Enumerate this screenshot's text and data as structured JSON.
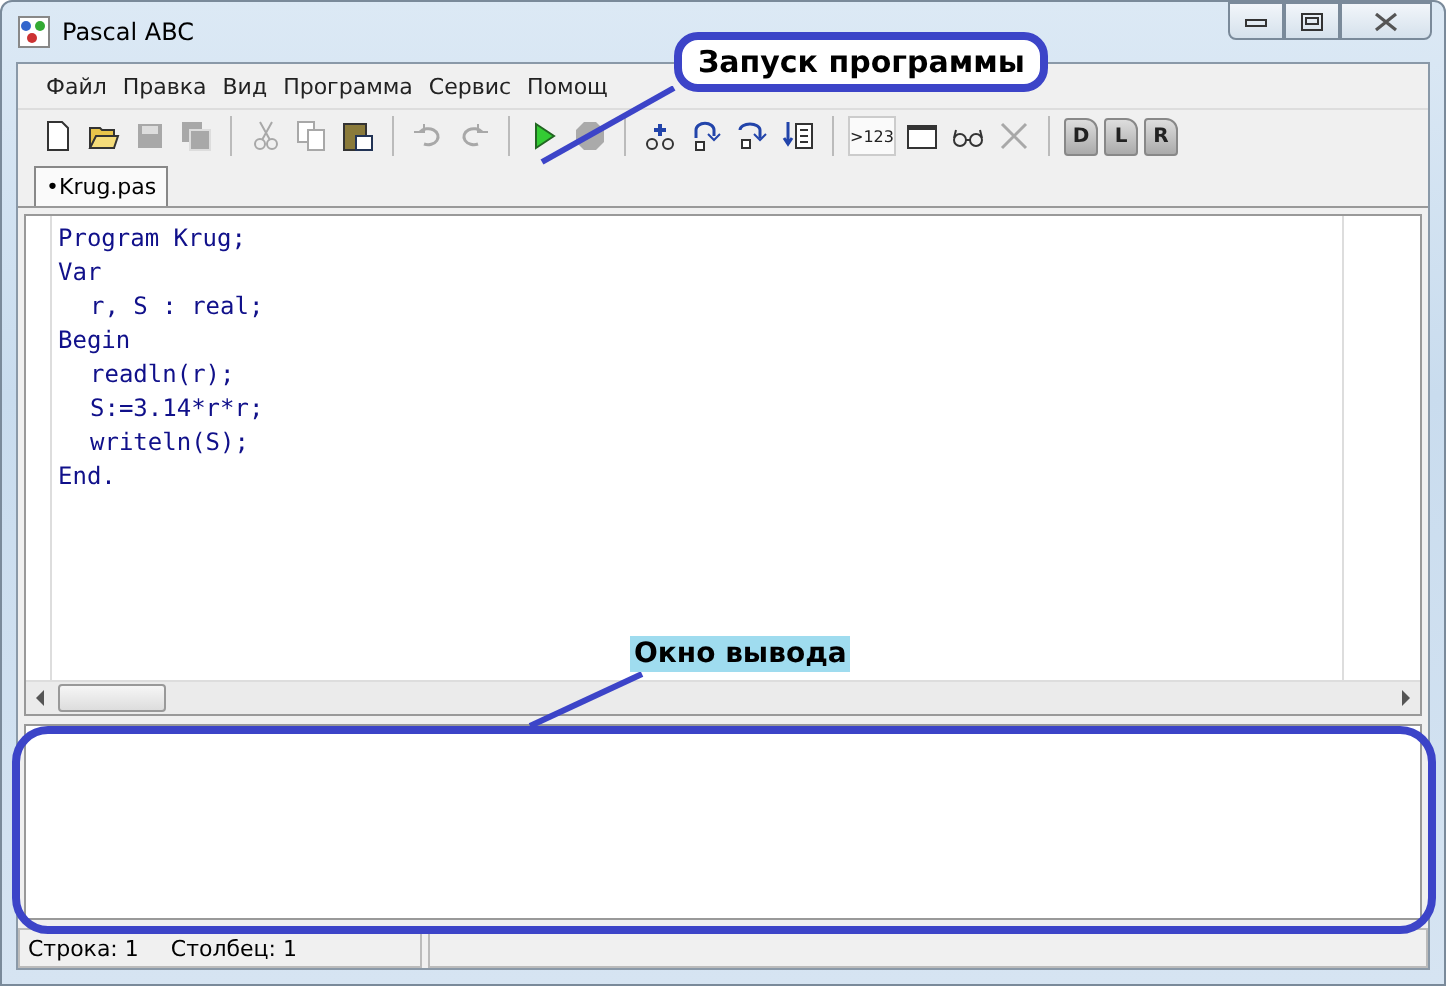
{
  "window": {
    "title": "Pascal ABC"
  },
  "menu": [
    {
      "label": "Файл"
    },
    {
      "label": "Правка"
    },
    {
      "label": "Вид"
    },
    {
      "label": "Программа"
    },
    {
      "label": "Сервис"
    },
    {
      "label": "Помощ"
    }
  ],
  "toolbar": [
    {
      "kind": "new",
      "disabled": false
    },
    {
      "kind": "open",
      "disabled": false
    },
    {
      "kind": "save",
      "disabled": true
    },
    {
      "kind": "saveall",
      "disabled": true
    },
    {
      "kind": "sep"
    },
    {
      "kind": "cut",
      "disabled": true
    },
    {
      "kind": "copy",
      "disabled": true
    },
    {
      "kind": "paste",
      "disabled": false
    },
    {
      "kind": "sep"
    },
    {
      "kind": "undo",
      "disabled": true
    },
    {
      "kind": "redo",
      "disabled": true
    },
    {
      "kind": "sep"
    },
    {
      "kind": "run",
      "disabled": false
    },
    {
      "kind": "stop",
      "disabled": true
    },
    {
      "kind": "sep"
    },
    {
      "kind": "watch",
      "disabled": false
    },
    {
      "kind": "stepover",
      "disabled": false
    },
    {
      "kind": "stepinto",
      "disabled": false
    },
    {
      "kind": "gotocursor",
      "disabled": false
    },
    {
      "kind": "sep"
    },
    {
      "kind": "text",
      "label": ">123",
      "selected": true,
      "disabled": false
    },
    {
      "kind": "window",
      "disabled": false
    },
    {
      "kind": "glasses",
      "disabled": false
    },
    {
      "kind": "delete",
      "disabled": true
    },
    {
      "kind": "sep"
    },
    {
      "kind": "page",
      "label": "D",
      "disabled": false
    },
    {
      "kind": "page",
      "label": "L",
      "disabled": false
    },
    {
      "kind": "page",
      "label": "R",
      "disabled": false
    }
  ],
  "tabs": [
    {
      "label": "•Krug.pas",
      "selected": true
    }
  ],
  "code": [
    {
      "text": "Program Krug;"
    },
    {
      "text": "Var",
      "children": [
        {
          "text": "r, S : real;"
        }
      ]
    },
    {
      "text": "Begin",
      "children": [
        {
          "text": "readln(r);"
        },
        {
          "text": "S:=3.14*r*r;"
        },
        {
          "text": "writeln(S);"
        }
      ]
    },
    {
      "text": "End."
    }
  ],
  "annotations": {
    "run": "Запуск программы",
    "output": "Окно вывода"
  },
  "status_bar": {
    "line": "Строка: 1",
    "column": "Столбец: 1"
  }
}
